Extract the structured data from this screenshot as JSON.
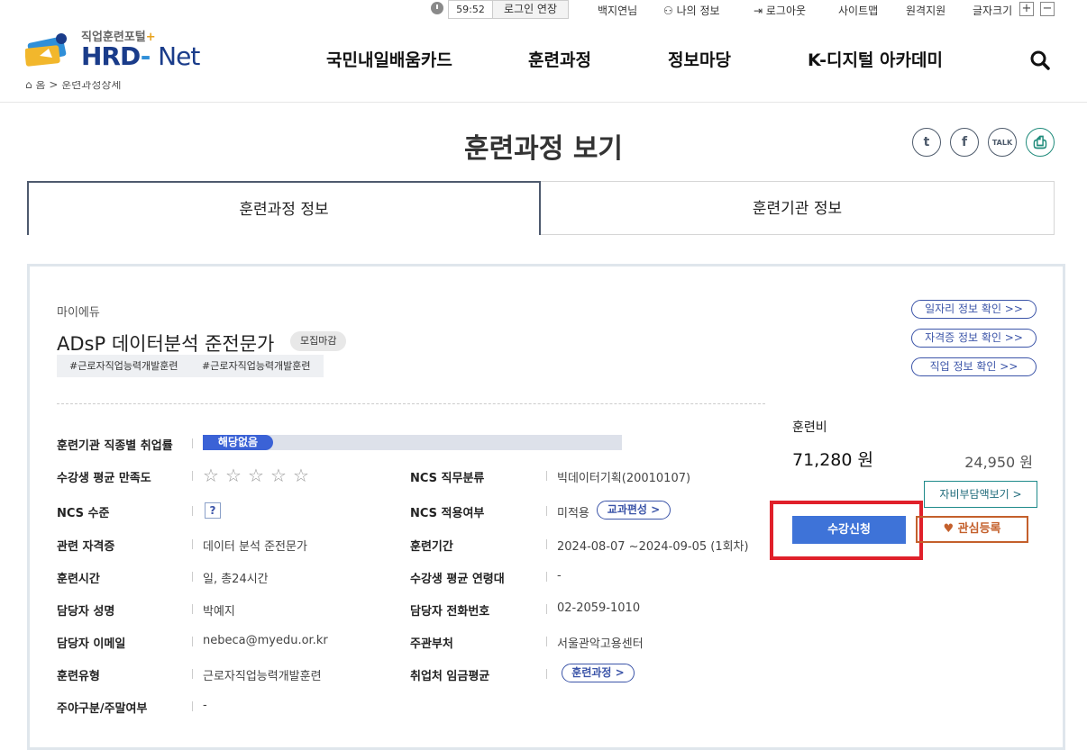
{
  "top_util": {
    "timer": "59:52",
    "extend_login": "로그인 연장",
    "username": "백지연님",
    "my_info": "나의 정보",
    "logout": "로그아웃",
    "sitemap": "사이트맵",
    "remote_support": "원격지원",
    "font_size": "글자크기",
    "font_plus": "+",
    "font_minus": "−"
  },
  "logo": {
    "small": "직업훈련포털",
    "plus": "+",
    "hrd": "HRD",
    "dash": "-",
    "net": "Net"
  },
  "nav": [
    "국민내일배움카드",
    "훈련과정",
    "정보마당",
    "K-디지털 아카데미"
  ],
  "breadcrumb": {
    "home": "홈",
    "sep": ">",
    "current": "훈련과정상세"
  },
  "page_title": "훈련과정 보기",
  "share": {
    "twitter": "t",
    "facebook": "f",
    "kakao": "TALK",
    "print": "⎙"
  },
  "tabs": [
    "훈련과정 정보",
    "훈련기관 정보"
  ],
  "course": {
    "provider": "마이에듀",
    "title": "ADsP 데이터분석 준전문가",
    "status": "모집마감",
    "tags": [
      "#근로자직업능력개발훈련",
      "#근로자직업능력개발훈련"
    ]
  },
  "side_links": [
    "일자리 정보 확인 >>",
    "자격증 정보 확인 >>",
    "직업 정보 확인 >>"
  ],
  "details": {
    "employment_rate_label": "훈련기관 직종별 취업률",
    "employment_rate_value": "해당없음",
    "satisfaction_label": "수강생 평균 만족도",
    "satisfaction_stars": "0",
    "ncs_level_label": "NCS 수준",
    "ncs_level_value": "?",
    "cert_label": "관련 자격증",
    "cert_value": "데이터 분석 준전문가",
    "hours_label": "훈련시간",
    "hours_value": "일, 총24시간",
    "manager_label": "담당자 성명",
    "manager_value": "박예지",
    "email_label": "담당자 이메일",
    "email_value": "nebeca@myedu.or.kr",
    "type_label": "훈련유형",
    "type_value": "근로자직업능력개발훈련",
    "daynight_label": "주야구분/주말여부",
    "daynight_value": "-",
    "ncs_job_label": "NCS 직무분류",
    "ncs_job_value": "빅데이터기획(20010107)",
    "ncs_apply_label": "NCS 적용여부",
    "ncs_apply_value": "미적용",
    "curriculum_btn": "교과편성 >",
    "period_label": "훈련기간",
    "period_value": "2024-08-07 ~2024-09-05 (1회차)",
    "age_label": "수강생 평균 연령대",
    "age_value": "-",
    "phone_label": "담당자 전화번호",
    "phone_value": "02-2059-1010",
    "agency_label": "주관부처",
    "agency_value": "서울관악고용센터",
    "wage_label": "취업처 임금평균",
    "wage_btn": "훈련과정 >"
  },
  "fee": {
    "label": "훈련비",
    "main": "71,280 원",
    "self": "24,950 원",
    "self_btn": "자비부담액보기 >",
    "apply_btn": "수강신청",
    "fav_btn": "관심등록"
  },
  "colors": {
    "accent": "#3e73d8",
    "highlight": "#e0202a",
    "fav": "#c4602c"
  }
}
